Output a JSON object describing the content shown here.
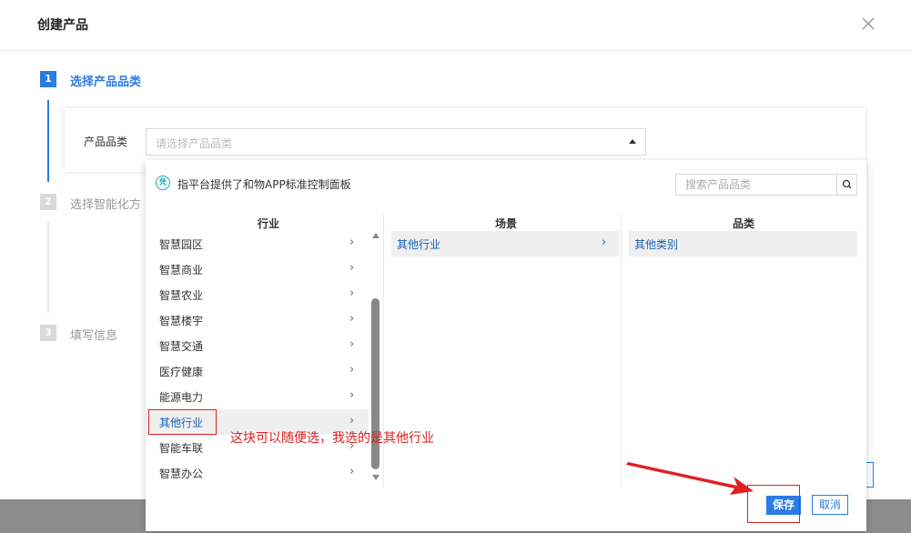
{
  "modal": {
    "title": "创建产品"
  },
  "steps": [
    {
      "number": "1",
      "label": "选择产品品类",
      "active": true
    },
    {
      "number": "2",
      "label": "选择智能化方",
      "active": false
    },
    {
      "number": "3",
      "label": "填写信息",
      "active": false
    }
  ],
  "form": {
    "category_label": "产品品类",
    "category_placeholder": "请选择产品品类"
  },
  "dropdown": {
    "info_icon_text": "凭",
    "info_text": "指平台提供了和物APP标准控制面板",
    "search_placeholder": "搜索产品品类",
    "columns": [
      "行业",
      "场景",
      "品类"
    ],
    "industries": [
      "智慧园区",
      "智慧商业",
      "智慧农业",
      "智慧楼宇",
      "智慧交通",
      "医疗健康",
      "能源电力",
      "其他行业",
      "智能车联",
      "智慧办公"
    ],
    "selected_industry": "其他行业",
    "scenes": [
      "其他行业"
    ],
    "categories": [
      "其他类别"
    ],
    "chevron": "›",
    "save_label": "保存",
    "cancel_label": "取消"
  },
  "annotation": {
    "text": "这块可以随便选，我选的是其他行业"
  },
  "colors": {
    "primary": "#2a7be4",
    "annotation_red": "#e02020",
    "step_inactive": "#d9d9d9",
    "selected_bg": "#efefef"
  }
}
